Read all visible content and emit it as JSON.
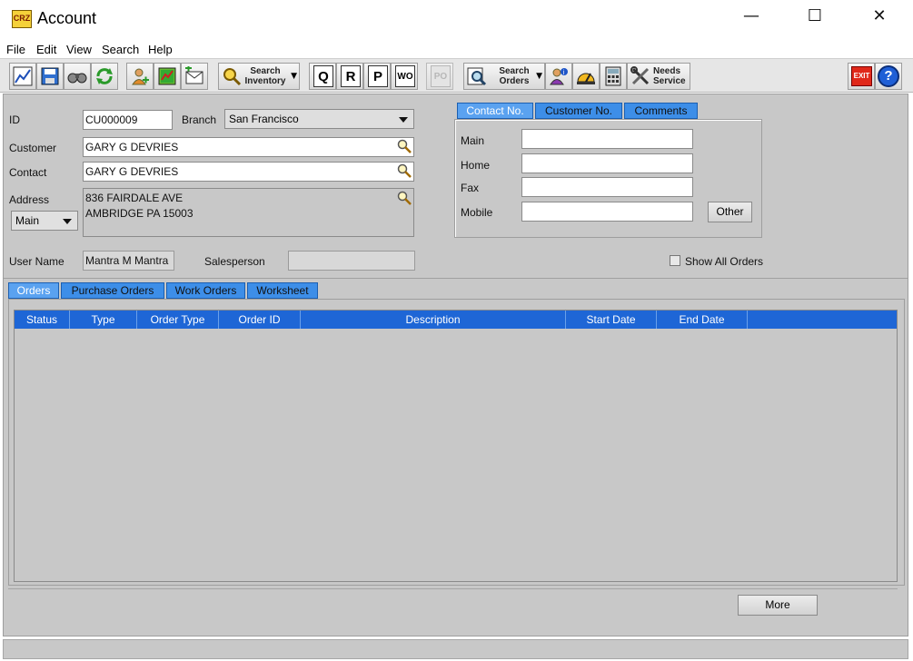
{
  "window": {
    "title": "Account",
    "app_icon_text": "CRZ",
    "minimize_glyph": "—",
    "maximize_glyph": "☐",
    "close_glyph": "✕"
  },
  "menu": [
    "File",
    "Edit",
    "View",
    "Search",
    "Help"
  ],
  "toolbar": {
    "search_inventory_line1": "Search",
    "search_inventory_line2": "Inventory",
    "doc_q": "Q",
    "doc_r": "R",
    "doc_p": "P",
    "doc_wo": "WO",
    "doc_po": "PO",
    "search_orders_line1": "Search",
    "search_orders_line2": "Orders",
    "needs_service_line1": "Needs",
    "needs_service_line2": "Service",
    "exit_label": "EXIT",
    "help_label": "?"
  },
  "form": {
    "id_label": "ID",
    "id_value": "CU000009",
    "branch_label": "Branch",
    "branch_value": "San Francisco",
    "customer_label": "Customer",
    "customer_value": "GARY G  DEVRIES",
    "contact_label": "Contact",
    "contact_value": "GARY G  DEVRIES",
    "address_label": "Address",
    "address_type": "Main",
    "address_line1": "836 FAIRDALE AVE",
    "address_line2": "AMBRIDGE PA 15003",
    "username_label": "User Name",
    "username_value": "Mantra M Mantra",
    "salesperson_label": "Salesperson",
    "salesperson_value": "",
    "show_all_orders_label": "Show All Orders",
    "show_all_orders_checked": false
  },
  "contact_tabs": [
    "Contact No.",
    "Customer No.",
    "Comments"
  ],
  "phones": {
    "main_label": "Main",
    "home_label": "Home",
    "fax_label": "Fax",
    "mobile_label": "Mobile",
    "main_value": "",
    "home_value": "",
    "fax_value": "",
    "mobile_value": "",
    "other_button": "Other"
  },
  "order_tabs": [
    "Orders",
    "Purchase Orders",
    "Work Orders",
    "Worksheet"
  ],
  "orders_table": {
    "columns": [
      "Status",
      "Type",
      "Order Type",
      "Order ID",
      "Description",
      "Start Date",
      "End Date"
    ],
    "rows": []
  },
  "more_button": "More",
  "colors": {
    "tab_blue": "#3d8ee8",
    "grid_header_blue": "#1e66d6",
    "panel_gray": "#c8c8c8"
  }
}
